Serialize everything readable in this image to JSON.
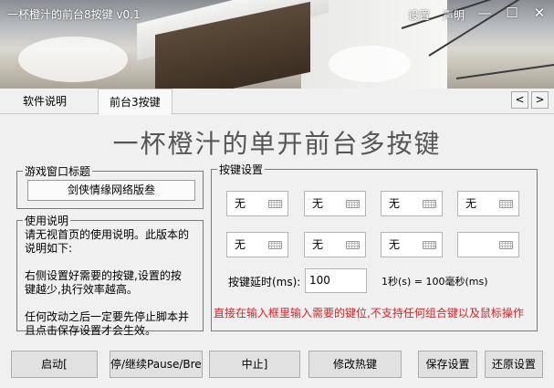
{
  "window": {
    "title": "一杯橙汁的前台8按键 v0.1",
    "menu_settings": "设置",
    "menu_statement": "声明",
    "minimize_glyph": "—",
    "maximize_glyph": "☐",
    "close_glyph": "✕"
  },
  "tabs": [
    {
      "label": "软件说明",
      "active": false
    },
    {
      "label": "前台3按键",
      "active": true
    }
  ],
  "tab_scroll": {
    "left": "<",
    "right": ">"
  },
  "heading": "一杯橙汁的单开前台多按键",
  "game_window": {
    "legend": "游戏窗口标题",
    "value": "剑侠情缘网络版叁"
  },
  "usage": {
    "legend": "使用说明",
    "text": "请无视首页的使用说明。此版本的\n说明如下:\n\n右侧设置好需要的按键,设置的按\n键越少,执行效率越高。\n\n任何改动之后一定要先停止脚本并\n且点击保存设置才会生效。"
  },
  "key_settings": {
    "legend": "按键设置",
    "keys": [
      "无",
      "无",
      "无",
      "无",
      "无",
      "无",
      "无",
      ""
    ],
    "delay_label": "按键延时(ms):",
    "delay_value": "100",
    "delay_note": "1秒(s) = 100毫秒(ms)",
    "warning": "直接在输入框里输入需要的键位,不支持任何组合键以及鼠标操作"
  },
  "buttons": {
    "start": "启动[",
    "pause": "停/继续Pause/Brea",
    "stop": "中止]",
    "hotkey": "修改热键",
    "save": "保存设置",
    "restore": "还原设置"
  },
  "colors": {
    "warning": "#e02020",
    "heading": "#555555"
  }
}
